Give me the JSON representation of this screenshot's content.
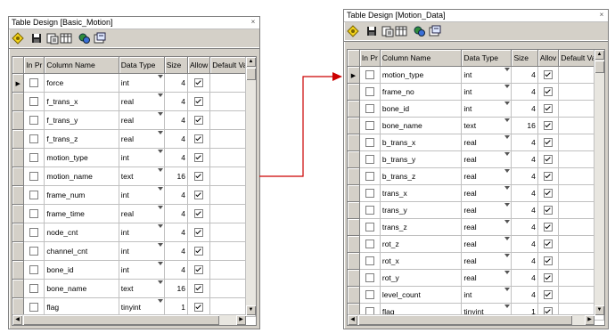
{
  "left_window": {
    "title": "Table Design [Basic_Motion]",
    "columns": [
      "In Pr",
      "Column Name",
      "Data Type",
      "Size",
      "Allow",
      "Default Valu"
    ],
    "rows": [
      {
        "name": "force",
        "type": "int",
        "size": "4",
        "allow": true,
        "current": true
      },
      {
        "name": "f_trans_x",
        "type": "real",
        "size": "4",
        "allow": true
      },
      {
        "name": "f_trans_y",
        "type": "real",
        "size": "4",
        "allow": true
      },
      {
        "name": "f_trans_z",
        "type": "real",
        "size": "4",
        "allow": true
      },
      {
        "name": "motion_type",
        "type": "int",
        "size": "4",
        "allow": true
      },
      {
        "name": "motion_name",
        "type": "text",
        "size": "16",
        "allow": true
      },
      {
        "name": "frame_num",
        "type": "int",
        "size": "4",
        "allow": true
      },
      {
        "name": "frame_time",
        "type": "real",
        "size": "4",
        "allow": true
      },
      {
        "name": "node_cnt",
        "type": "int",
        "size": "4",
        "allow": true
      },
      {
        "name": "channel_cnt",
        "type": "int",
        "size": "4",
        "allow": true
      },
      {
        "name": "bone_id",
        "type": "int",
        "size": "4",
        "allow": true
      },
      {
        "name": "bone_name",
        "type": "text",
        "size": "16",
        "allow": true
      },
      {
        "name": "flag",
        "type": "tinyint",
        "size": "1",
        "allow": true
      }
    ]
  },
  "right_window": {
    "title": "Table Design [Motion_Data]",
    "columns": [
      "In Pr",
      "Column Name",
      "Data Type",
      "Size",
      "Allov",
      "Default Valu"
    ],
    "rows": [
      {
        "name": "motion_type",
        "type": "int",
        "size": "4",
        "allow": true,
        "current": true
      },
      {
        "name": "frame_no",
        "type": "int",
        "size": "4",
        "allow": true
      },
      {
        "name": "bone_id",
        "type": "int",
        "size": "4",
        "allow": true
      },
      {
        "name": "bone_name",
        "type": "text",
        "size": "16",
        "allow": true
      },
      {
        "name": "b_trans_x",
        "type": "real",
        "size": "4",
        "allow": true
      },
      {
        "name": "b_trans_y",
        "type": "real",
        "size": "4",
        "allow": true
      },
      {
        "name": "b_trans_z",
        "type": "real",
        "size": "4",
        "allow": true
      },
      {
        "name": "trans_x",
        "type": "real",
        "size": "4",
        "allow": true
      },
      {
        "name": "trans_y",
        "type": "real",
        "size": "4",
        "allow": true
      },
      {
        "name": "trans_z",
        "type": "real",
        "size": "4",
        "allow": true
      },
      {
        "name": "rot_z",
        "type": "real",
        "size": "4",
        "allow": true
      },
      {
        "name": "rot_x",
        "type": "real",
        "size": "4",
        "allow": true
      },
      {
        "name": "rot_y",
        "type": "real",
        "size": "4",
        "allow": true
      },
      {
        "name": "level_count",
        "type": "int",
        "size": "4",
        "allow": true
      },
      {
        "name": "flag",
        "type": "tinyint",
        "size": "1",
        "allow": true
      }
    ]
  },
  "toolbar_icons": [
    "key-icon",
    "save-icon",
    "properties-icon",
    "manage-indexes-icon",
    "relationships-icon",
    "script-icon"
  ],
  "connector_color": "#cc0000"
}
